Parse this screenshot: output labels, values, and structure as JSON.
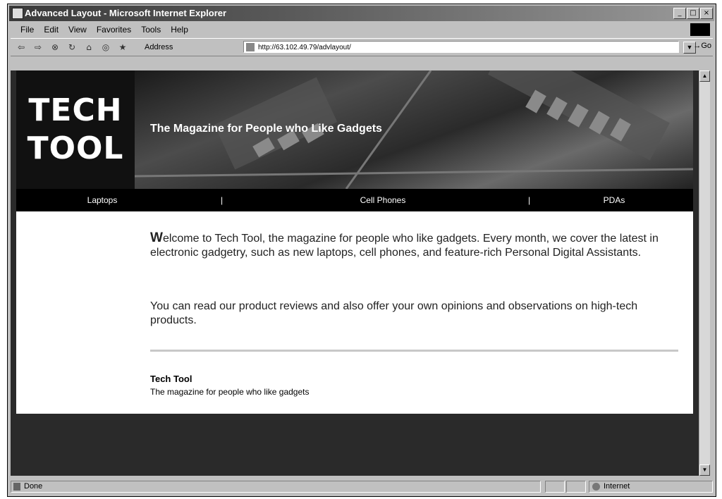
{
  "window": {
    "title": "Advanced Layout - Microsoft Internet Explorer",
    "minimize_glyph": "_",
    "maximize_glyph": "□",
    "close_glyph": "×"
  },
  "menu": [
    "File",
    "Edit",
    "View",
    "Favorites",
    "Tools",
    "Help"
  ],
  "toolbar": {
    "address_label": "Address",
    "url": "http://63.102.49.79/advlayout/",
    "go_label": "Go",
    "icons": [
      "back-icon",
      "forward-icon",
      "stop-icon",
      "refresh-icon",
      "home-icon",
      "search-icon",
      "favorites-icon"
    ]
  },
  "page": {
    "brand_line1": "TECH",
    "brand_line2": "TOOL",
    "tagline": "The Magazine for People who Like Gadgets",
    "nav": [
      "Laptops",
      "Cell Phones",
      "PDAs"
    ],
    "nav_separator": "|",
    "intro_dropcap": "W",
    "intro_rest": "elcome to Tech Tool, the magazine for people who like gadgets. Every month, we cover the latest in electronic gadgetry, such as new laptops, cell phones, and feature-rich Personal Digital Assistants.",
    "para2": "You can read our product reviews and also offer your own opinions and observations on high-tech products.",
    "footer_title": "Tech Tool",
    "footer_sub": "The magazine for people who like gadgets"
  },
  "status": {
    "text": "Done",
    "zone": "Internet"
  },
  "colors": {
    "banner_bg": "#111111",
    "page_bg": "#2a2a2a",
    "content_bg": "#ffffff",
    "chrome": "#c0c0c0"
  }
}
